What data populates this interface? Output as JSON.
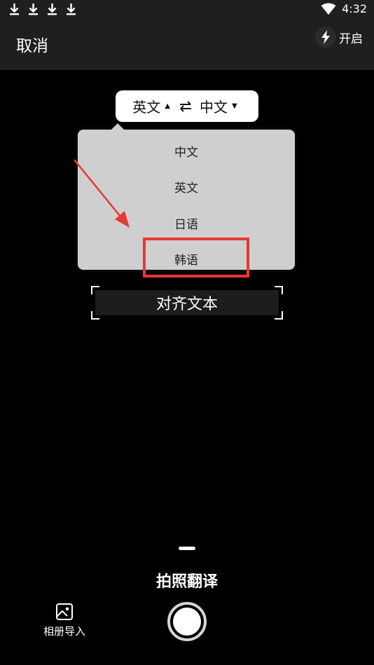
{
  "status": {
    "time": "4:32"
  },
  "topbar": {
    "cancel_label": "取消",
    "flash_label": "开启"
  },
  "lang_selector": {
    "source": "英文",
    "target": "中文"
  },
  "dropdown": {
    "items": [
      "中文",
      "英文",
      "日语",
      "韩语"
    ]
  },
  "align_text": "对齐文本",
  "mode_label": "拍照翻译",
  "album_label": "相册导入",
  "colors": {
    "highlight": "#e53935",
    "bar": "#1f1f1f"
  }
}
